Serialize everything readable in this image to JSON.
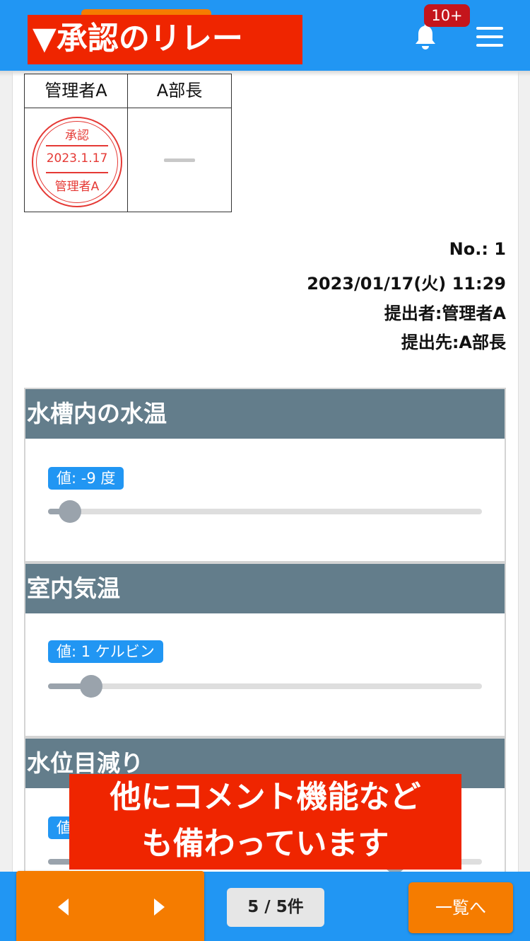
{
  "header": {
    "title": "▼承認のリレー",
    "notification_badge": "10+"
  },
  "approval": {
    "columns": [
      "管理者A",
      "A部長"
    ],
    "stamp": {
      "status": "承認",
      "date": "2023.1.17",
      "approver": "管理者A"
    },
    "pending_mark": "—"
  },
  "meta": {
    "number": "No.: 1",
    "datetime": "2023/01/17(火) 11:29",
    "submitter": "提出者:管理者A",
    "recipient": "提出先:A部長"
  },
  "sections": [
    {
      "title": "水槽内の水温",
      "value_label": "値: -9 度",
      "slider_fraction": 0.05
    },
    {
      "title": "室内気温",
      "value_label": "値: 1 ケルビン",
      "slider_fraction": 0.1
    },
    {
      "title": "水位目減り",
      "value_label": "値",
      "slider_fraction": 0.8
    }
  ],
  "overlay": {
    "line1": "他にコメント機能など",
    "line2": "も備わっています"
  },
  "footer": {
    "pager": "5 / 5件",
    "list_button": "一覧へ"
  },
  "colors": {
    "primary": "#2196f3",
    "accent": "#f57c00",
    "banner": "#ef2500",
    "section_header": "#637d8b",
    "stamp": "#e53935"
  }
}
